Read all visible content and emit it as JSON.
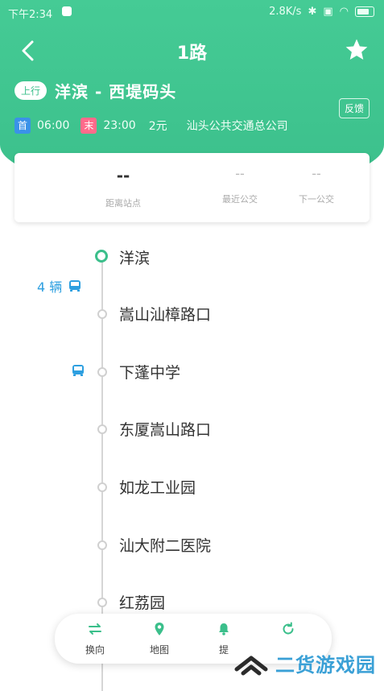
{
  "status_bar": {
    "time": "下午2:34",
    "net_speed": "2.8K/s"
  },
  "header": {
    "title": "1路"
  },
  "route": {
    "direction_badge": "上行",
    "name": "洋滨 - 西堤码头",
    "feedback": "反馈",
    "first_tag": "首",
    "first_time": "06:00",
    "last_tag": "末",
    "last_time": "23:00",
    "fare": "2元",
    "company": "汕头公共交通总公司"
  },
  "card": {
    "cells": [
      {
        "value": "--",
        "label": "距离站点"
      },
      {
        "value": "--",
        "label": "最近公交"
      },
      {
        "value": "--",
        "label": "下一公交"
      }
    ]
  },
  "bus_count": "4 辆",
  "stops": [
    "洋滨",
    "嵩山汕樟路口",
    "下蓬中学",
    "东厦嵩山路口",
    "如龙工业园",
    "汕大附二医院",
    "红荔园"
  ],
  "bottom_bar": {
    "items": [
      "换向",
      "地图",
      "提",
      ""
    ]
  },
  "watermark": {
    "text": "二货游戏园"
  },
  "colors": {
    "primary": "#3bbf8b",
    "accent_blue": "#2d9fe0",
    "first_tag": "#3a92e8",
    "last_tag": "#ff6b8b"
  }
}
